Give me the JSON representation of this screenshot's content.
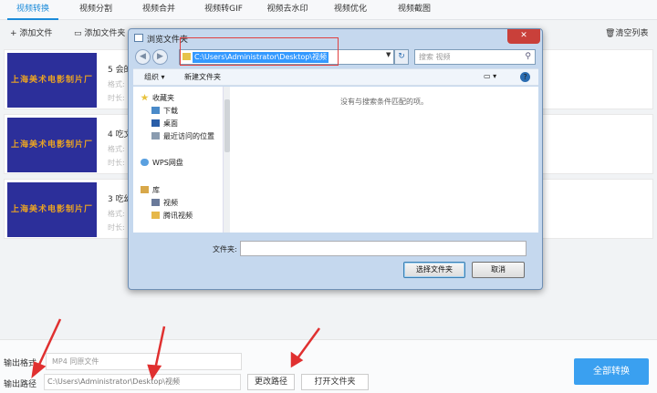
{
  "tabs": [
    "视频转换",
    "视频分割",
    "视频合并",
    "视频转GIF",
    "视频去水印",
    "视频优化",
    "视频截图"
  ],
  "toolbar": {
    "add_file": "添加文件",
    "add_folder": "添加文件夹",
    "clear_list": "清空列表"
  },
  "files": [
    {
      "name": "5 会的",
      "thumb_text": "上海美术电影制片厂",
      "format_label": "格式:",
      "duration_label": "时长:"
    },
    {
      "name": "4 吃文",
      "thumb_text": "上海美术电影制片厂",
      "format_label": "格式:",
      "duration_label": "时长:"
    },
    {
      "name": "3 吃幻",
      "thumb_text": "上海美术电影制片厂",
      "format_label": "格式:",
      "duration_label": "时长:"
    }
  ],
  "bottom": {
    "format_label": "输出格式",
    "format_value": "MP4   同原文件",
    "path_label": "输出路径",
    "path_value": "C:\\Users\\Administrator\\Desktop\\视频",
    "change_path": "更改路径",
    "open_folder": "打开文件夹",
    "convert_all": "全部转换"
  },
  "dialog": {
    "title": "浏览文件夹",
    "close": "✕",
    "address": "C:\\Users\\Administrator\\Desktop\\视频",
    "search_placeholder": "搜索 视频",
    "organize": "组织 ▾",
    "new_folder": "新建文件夹",
    "nav": {
      "favorites": "收藏夹",
      "downloads": "下载",
      "desktop": "桌面",
      "recent": "最近访问的位置",
      "wps": "WPS网盘",
      "library": "库",
      "videos": "视频",
      "tencent": "腾讯视频"
    },
    "empty_text": "没有与搜索条件匹配的项。",
    "filename_label": "文件夹:",
    "select_button": "选择文件夹",
    "cancel_button": "取消"
  },
  "colors": {
    "accent": "#1c8bd9",
    "convert": "#3aa0f0",
    "highlight": "#e04040",
    "thumb_bg": "#2c2f9a",
    "thumb_text": "#e8a224"
  }
}
